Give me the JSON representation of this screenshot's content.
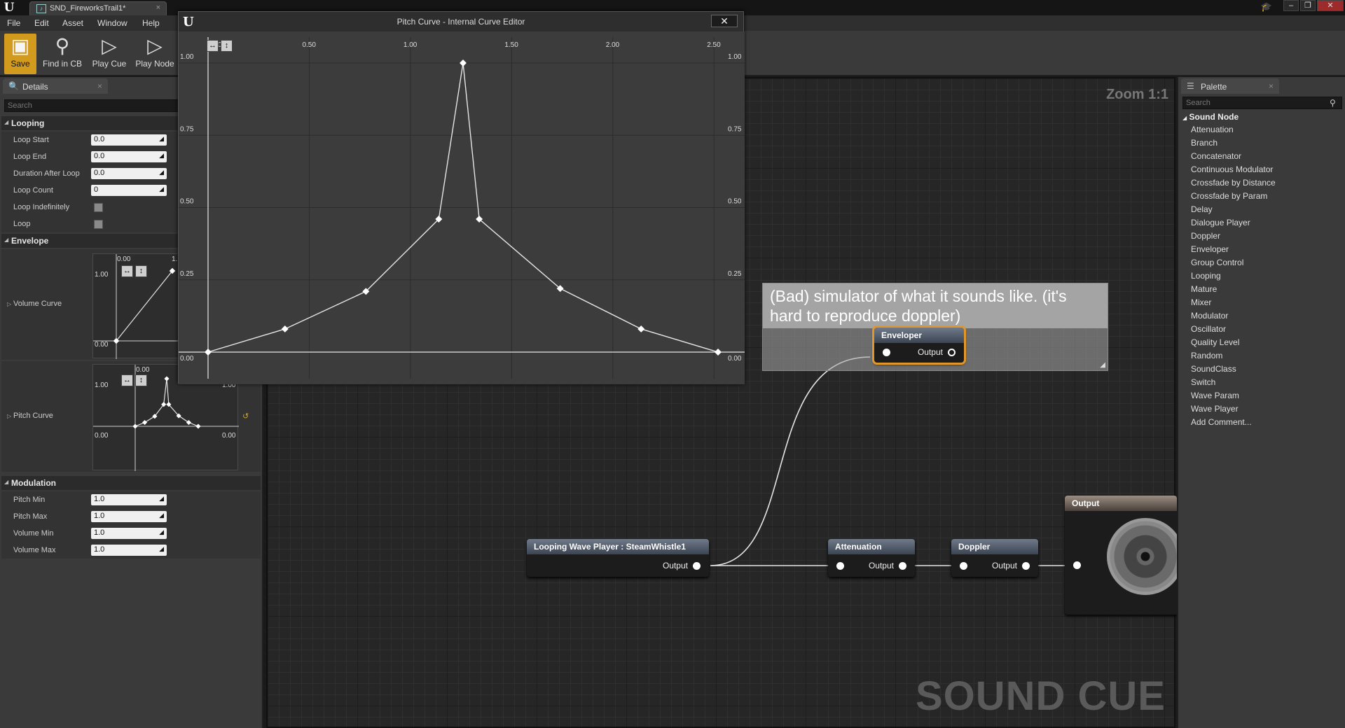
{
  "window": {
    "tab_title": "SND_FireworksTrail1*",
    "tab_icon": "sound-cue-icon",
    "tab_close": "×",
    "minimize": "–",
    "maximize": "❐",
    "close": "✕"
  },
  "menu": [
    "File",
    "Edit",
    "Asset",
    "Window",
    "Help"
  ],
  "toolbar": [
    {
      "label": "Save",
      "icon": "save-icon"
    },
    {
      "label": "Find in CB",
      "icon": "magnifier-icon"
    },
    {
      "label": "Play Cue",
      "icon": "play-icon"
    },
    {
      "label": "Play Node",
      "icon": "play-node-icon"
    }
  ],
  "details": {
    "tab_label": "Details",
    "search_placeholder": "Search",
    "looping": {
      "title": "Looping",
      "props": [
        {
          "label": "Loop Start",
          "value": "0.0"
        },
        {
          "label": "Loop End",
          "value": "0.0"
        },
        {
          "label": "Duration After Loop",
          "value": "0.0"
        },
        {
          "label": "Loop Count",
          "value": "0"
        }
      ],
      "checks": [
        {
          "label": "Loop Indefinitely",
          "checked": false
        },
        {
          "label": "Loop",
          "checked": false
        }
      ]
    },
    "envelope": {
      "title": "Envelope",
      "volume_curve_label": "Volume Curve",
      "pitch_curve_label": "Pitch Curve",
      "vol_tick_top": "1.00",
      "vol_tick_bottom": "0.00",
      "vol_tick_x0": "0.00",
      "vol_tick_x1": "1.",
      "pitch_tick_x0": "0.00",
      "pitch_tick_top": "1.00",
      "pitch_tick_top_right": "1.00",
      "pitch_tick_bottom": "0.00",
      "pitch_tick_bottom_right": "0.00"
    },
    "modulation": {
      "title": "Modulation",
      "props": [
        {
          "label": "Pitch Min",
          "value": "1.0"
        },
        {
          "label": "Pitch Max",
          "value": "1.0"
        },
        {
          "label": "Volume Min",
          "value": "1.0"
        },
        {
          "label": "Volume Max",
          "value": "1.0"
        }
      ]
    }
  },
  "curve_editor": {
    "title": "Pitch Curve - Internal Curve Editor",
    "x_ticks": [
      "0.00",
      "0.50",
      "1.00",
      "1.50",
      "2.00",
      "2.50"
    ],
    "y_ticks": [
      "1.00",
      "0.75",
      "0.50",
      "0.25",
      "0.00"
    ],
    "keys": [
      {
        "t": 0.0,
        "v": 0.0
      },
      {
        "t": 0.38,
        "v": 0.08
      },
      {
        "t": 0.78,
        "v": 0.21
      },
      {
        "t": 1.14,
        "v": 0.46
      },
      {
        "t": 1.26,
        "v": 1.0
      },
      {
        "t": 1.34,
        "v": 0.46
      },
      {
        "t": 1.74,
        "v": 0.22
      },
      {
        "t": 2.14,
        "v": 0.08
      },
      {
        "t": 2.52,
        "v": 0.0
      }
    ]
  },
  "graph": {
    "zoom": "Zoom 1:1",
    "watermark": "SOUND CUE",
    "comment": "(Bad) simulator of what it sounds like. (it's hard to reproduce doppler)",
    "nodes": {
      "enveloper": {
        "title": "Enveloper",
        "output": "Output"
      },
      "wave_player": {
        "title": "Looping Wave Player : SteamWhistle1",
        "output": "Output"
      },
      "attenuation": {
        "title": "Attenuation",
        "output": "Output"
      },
      "doppler": {
        "title": "Doppler",
        "output": "Output"
      },
      "output": {
        "title": "Output"
      }
    }
  },
  "palette": {
    "tab_label": "Palette",
    "search_placeholder": "Search",
    "category": "Sound Node",
    "items": [
      "Attenuation",
      "Branch",
      "Concatenator",
      "Continuous Modulator",
      "Crossfade by Distance",
      "Crossfade by Param",
      "Delay",
      "Dialogue Player",
      "Doppler",
      "Enveloper",
      "Group Control",
      "Looping",
      "Mature",
      "Mixer",
      "Modulator",
      "Oscillator",
      "Quality Level",
      "Random",
      "SoundClass",
      "Switch",
      "Wave Param",
      "Wave Player",
      "Add Comment..."
    ]
  }
}
